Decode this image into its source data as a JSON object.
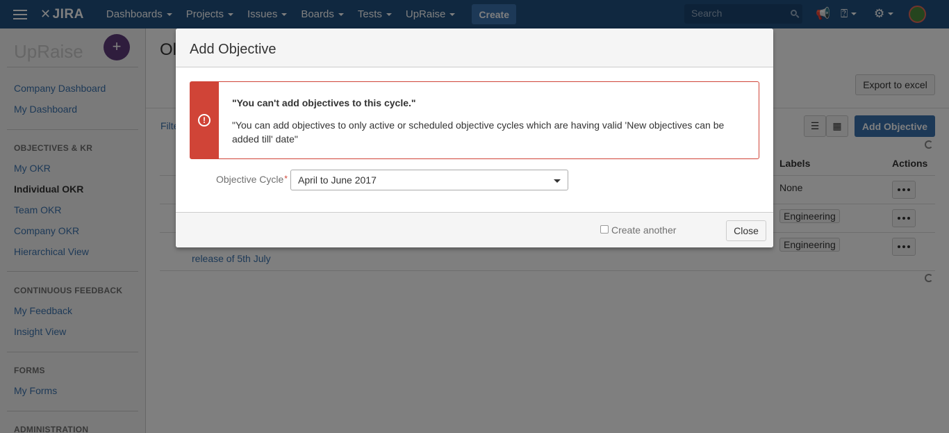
{
  "topnav": {
    "logo": "JIRA",
    "menu": [
      {
        "label": "Dashboards"
      },
      {
        "label": "Projects"
      },
      {
        "label": "Issues"
      },
      {
        "label": "Boards"
      },
      {
        "label": "Tests"
      },
      {
        "label": "UpRaise"
      }
    ],
    "create_label": "Create",
    "search_placeholder": "Search",
    "icons": [
      "hamburger-icon",
      "megaphone-icon",
      "help-icon",
      "gear-icon",
      "avatar"
    ]
  },
  "sidebar": {
    "title": "UpRaise",
    "add_label": "+",
    "links_top": [
      "Company Dashboard",
      "My Dashboard"
    ],
    "section_objectives": "OBJECTIVES & KR",
    "objective_links": [
      "My OKR",
      "Individual OKR",
      "Team OKR",
      "Company OKR",
      "Hierarchical View"
    ],
    "section_feedback": "CONTINUOUS FEEDBACK",
    "feedback_links": [
      "My Feedback",
      "Insight View"
    ],
    "section_forms": "FORMS",
    "forms_links": [
      "My Forms"
    ],
    "section_admin": "ADMINISTRATION"
  },
  "main": {
    "title_fragment": "Ol",
    "filter_fragment": "Filte",
    "export_label": "Export to excel",
    "add_objective_label": "Add Objective",
    "headers": {
      "labels": "Labels",
      "actions": "Actions"
    },
    "rows": [
      {
        "label": "None"
      },
      {
        "label": "Engineering"
      },
      {
        "label": "Engineering"
      }
    ],
    "row_text_fragment": "release of 5th July"
  },
  "dialog": {
    "title": "Add Objective",
    "error_title": "\"You can't add objectives to this cycle.\"",
    "error_body": "\"You can add objectives to only active or scheduled objective cycles which are having valid 'New objectives can be added till' date\"",
    "field_label": "Objective Cycle",
    "required_mark": "*",
    "selected_cycle": "April to June 2017",
    "create_another_label": "Create another",
    "close_label": "Close",
    "error_color": "#d04437"
  }
}
